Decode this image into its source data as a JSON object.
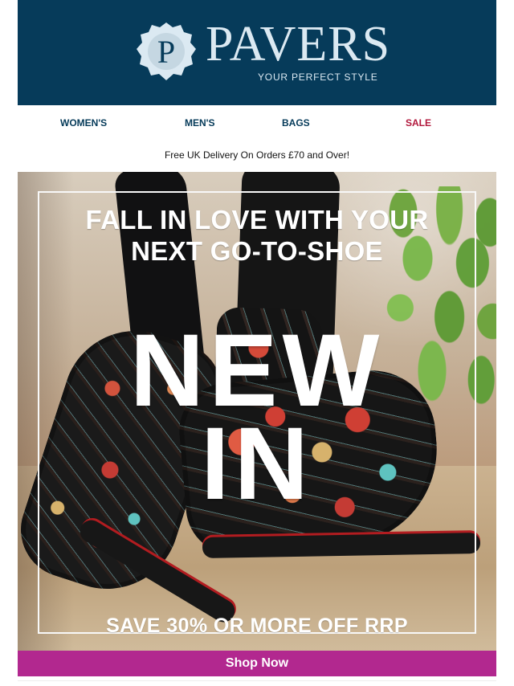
{
  "brand": {
    "logo_letter": "P",
    "name": "PAVERS",
    "tagline": "YOUR PERFECT STYLE",
    "header_background": "#063b5a",
    "logo_color": "#dbe9f2"
  },
  "nav": {
    "items": [
      {
        "label": "WOMEN'S",
        "color": "#063b5a"
      },
      {
        "label": "MEN'S",
        "color": "#063b5a"
      },
      {
        "label": "BAGS",
        "color": "#063b5a"
      },
      {
        "label": "SALE",
        "color": "#b2183c"
      }
    ]
  },
  "promo": {
    "delivery_text": "Free UK Delivery On Orders £70 and Over!"
  },
  "hero": {
    "headline_line_1": "FALL IN LOVE WITH YOUR",
    "headline_line_2": "NEXT GO-TO-SHOE",
    "big_text_line_1": "NEW",
    "big_text_line_2": "IN",
    "offer_text": "SAVE 30% OR MORE OFF RRP"
  },
  "cta": {
    "label": "Shop Now",
    "background": "#b2288f"
  }
}
